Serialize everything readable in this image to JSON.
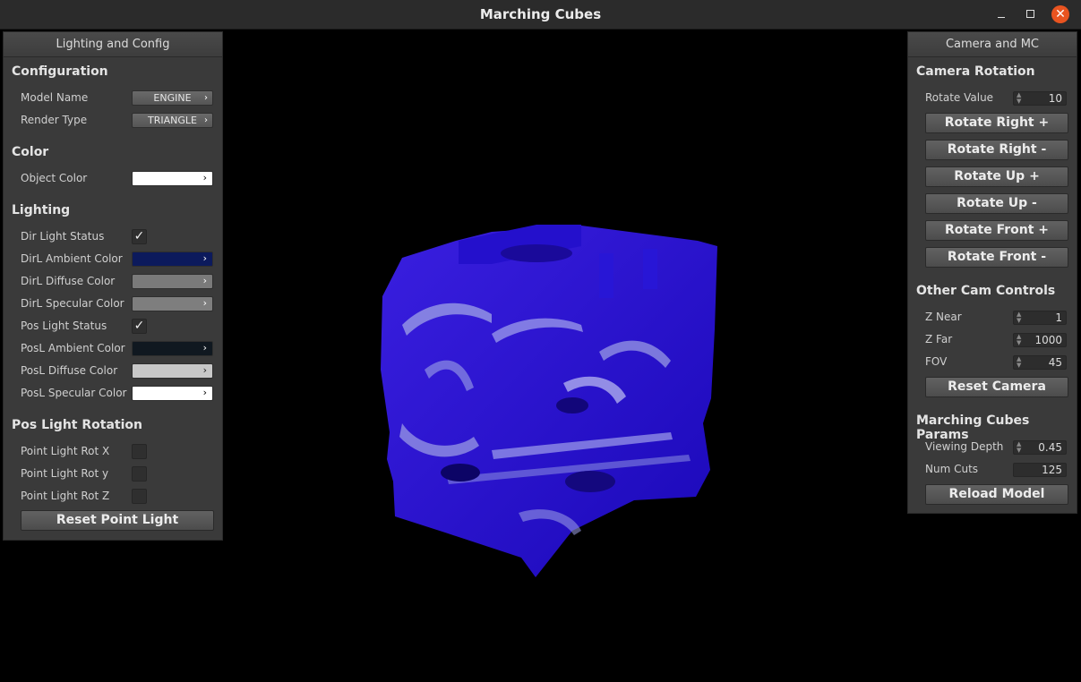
{
  "window": {
    "title": "Marching Cubes"
  },
  "left_panel": {
    "header": "Lighting and Config",
    "sections": {
      "configuration": "Configuration",
      "color": "Color",
      "lighting": "Lighting",
      "pos_light_rotation": "Pos Light Rotation"
    },
    "model_name": {
      "label": "Model Name",
      "value": "ENGINE"
    },
    "render_type": {
      "label": "Render Type",
      "value": "TRIANGLE"
    },
    "object_color": {
      "label": "Object Color",
      "color": "#ffffff"
    },
    "dir_light_status": {
      "label": "Dir Light Status",
      "checked": true
    },
    "dirl_ambient": {
      "label": "DirL Ambient Color",
      "color": "#0c1a5c"
    },
    "dirl_diffuse": {
      "label": "DirL Diffuse Color",
      "color": "#7a7a7a"
    },
    "dirl_specular": {
      "label": "DirL Specular Color",
      "color": "#7e7e7e"
    },
    "pos_light_status": {
      "label": "Pos Light Status",
      "checked": true
    },
    "posl_ambient": {
      "label": "PosL Ambient Color",
      "color": "#101820"
    },
    "posl_diffuse": {
      "label": "PosL Diffuse Color",
      "color": "#c8c8c8"
    },
    "posl_specular": {
      "label": "PosL Specular Color",
      "color": "#ffffff"
    },
    "rot_x": {
      "label": "Point Light Rot X",
      "checked": false
    },
    "rot_y": {
      "label": "Point Light Rot y",
      "checked": false
    },
    "rot_z": {
      "label": "Point Light Rot Z",
      "checked": false
    },
    "reset_point_light": "Reset Point Light"
  },
  "right_panel": {
    "header": "Camera and MC",
    "sections": {
      "camera_rotation": "Camera Rotation",
      "other_cam": "Other Cam Controls",
      "mc_params": "Marching Cubes Params"
    },
    "rotate_value": {
      "label": "Rotate Value",
      "value": "10"
    },
    "buttons": {
      "rotate_right_plus": "Rotate Right +",
      "rotate_right_minus": "Rotate Right -",
      "rotate_up_plus": "Rotate Up +",
      "rotate_up_minus": "Rotate Up -",
      "rotate_front_plus": "Rotate Front +",
      "rotate_front_minus": "Rotate Front -",
      "reset_camera": "Reset Camera",
      "reload_model": "Reload Model"
    },
    "z_near": {
      "label": "Z Near",
      "value": "1"
    },
    "z_far": {
      "label": "Z Far",
      "value": "1000"
    },
    "fov": {
      "label": "FOV",
      "value": "45"
    },
    "viewing_depth": {
      "label": "Viewing Depth",
      "value": "0.45"
    },
    "num_cuts": {
      "label": "Num Cuts",
      "value": "125"
    }
  },
  "viewport": {
    "model_color": "#2a10d8",
    "highlight_color": "#9fa3e6"
  }
}
